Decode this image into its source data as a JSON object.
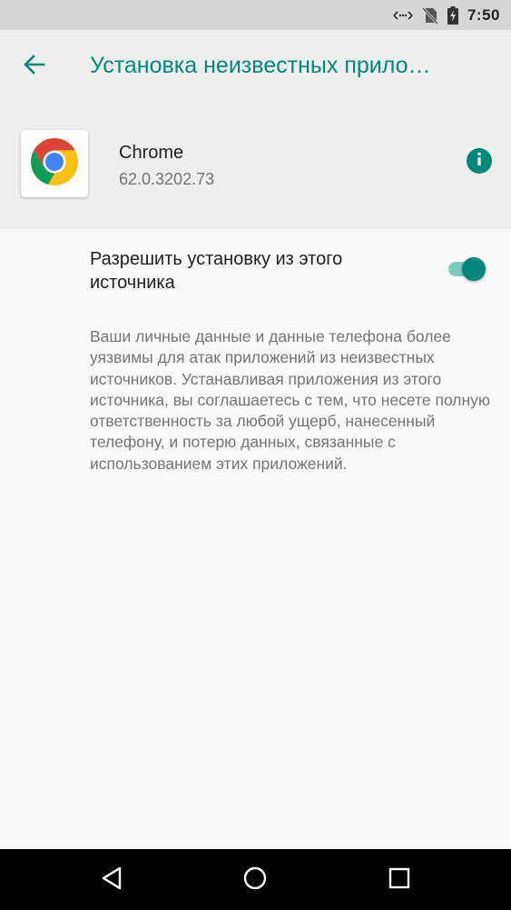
{
  "status_bar": {
    "time": "7:50",
    "icons": [
      "data-arrows-icon",
      "no-sim-icon",
      "battery-charging-icon"
    ]
  },
  "toolbar": {
    "title": "Установка неизвестных прило…",
    "back_icon": "arrow-back-icon",
    "accent_color": "#00897b"
  },
  "app": {
    "name": "Chrome",
    "version": "62.0.3202.73",
    "icon": "chrome-icon",
    "info_icon": "info-icon"
  },
  "setting": {
    "label": "Разрешить установку из этого источника",
    "enabled": true
  },
  "warning": "Ваши личные данные и данные телефона более уязвимы для атак приложений из неизвестных источников. Устанавливая приложения из этого источника, вы соглашаетесь с тем, что несете полную ответственность за любой ущерб, нанесенный телефону, и потерю данных, связанные с использованием этих приложений.",
  "nav_bar": {
    "back_icon": "nav-back-icon",
    "home_icon": "nav-home-icon",
    "recents_icon": "nav-recents-icon"
  }
}
